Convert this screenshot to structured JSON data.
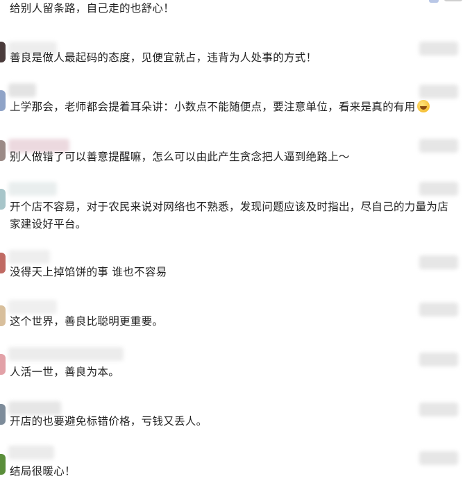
{
  "comments": [
    {
      "text": "给别人留条路，自己走的也舒心！",
      "avatar_color": "#c9d3df",
      "name_color": "#eeeeee"
    },
    {
      "text": "善良是做人最起码的态度，见便宜就占，违背为人处事的方式！",
      "avatar_color": "#4a3b3b",
      "name_color": "#ededed"
    },
    {
      "text": "上学那会，老师都会提着耳朵讲：小数点不能随便点，要注意单位，看来是真的有用",
      "avatar_color": "#8fa3c7",
      "name_color": "#e3e3e3"
    },
    {
      "text": "别人做错了可以善意提醒嘛，怎么可以由此产生贪念把人逼到绝路上～",
      "avatar_color": "#9b8a86",
      "name_color": "#ecd9df"
    },
    {
      "text": "开个店不容易，对于农民来说对网络也不熟悉，发现问题应该及时指出，尽自己的力量为店家建设好平台。",
      "avatar_color": "#a7c5c9",
      "name_color": "#e9eeee"
    },
    {
      "text": "没得天上掉馅饼的事 谁也不容易",
      "avatar_color": "#c06a63",
      "name_color": "#eeeeee"
    },
    {
      "text": "这个世界，善良比聪明更重要。",
      "avatar_color": "#d8bf9c",
      "name_color": "#efefef"
    },
    {
      "text": "人活一世，善良为本。",
      "avatar_color": "#e2a1a7",
      "name_color": "#ececec"
    },
    {
      "text": "开店的也要避免标错价格，亏钱又丢人。",
      "avatar_color": "#7d8c9a",
      "name_color": "#e6e6e6"
    },
    {
      "text": "结局很暖心！",
      "avatar_color": "#5a8e3a",
      "name_color": "#ebebeb"
    }
  ]
}
